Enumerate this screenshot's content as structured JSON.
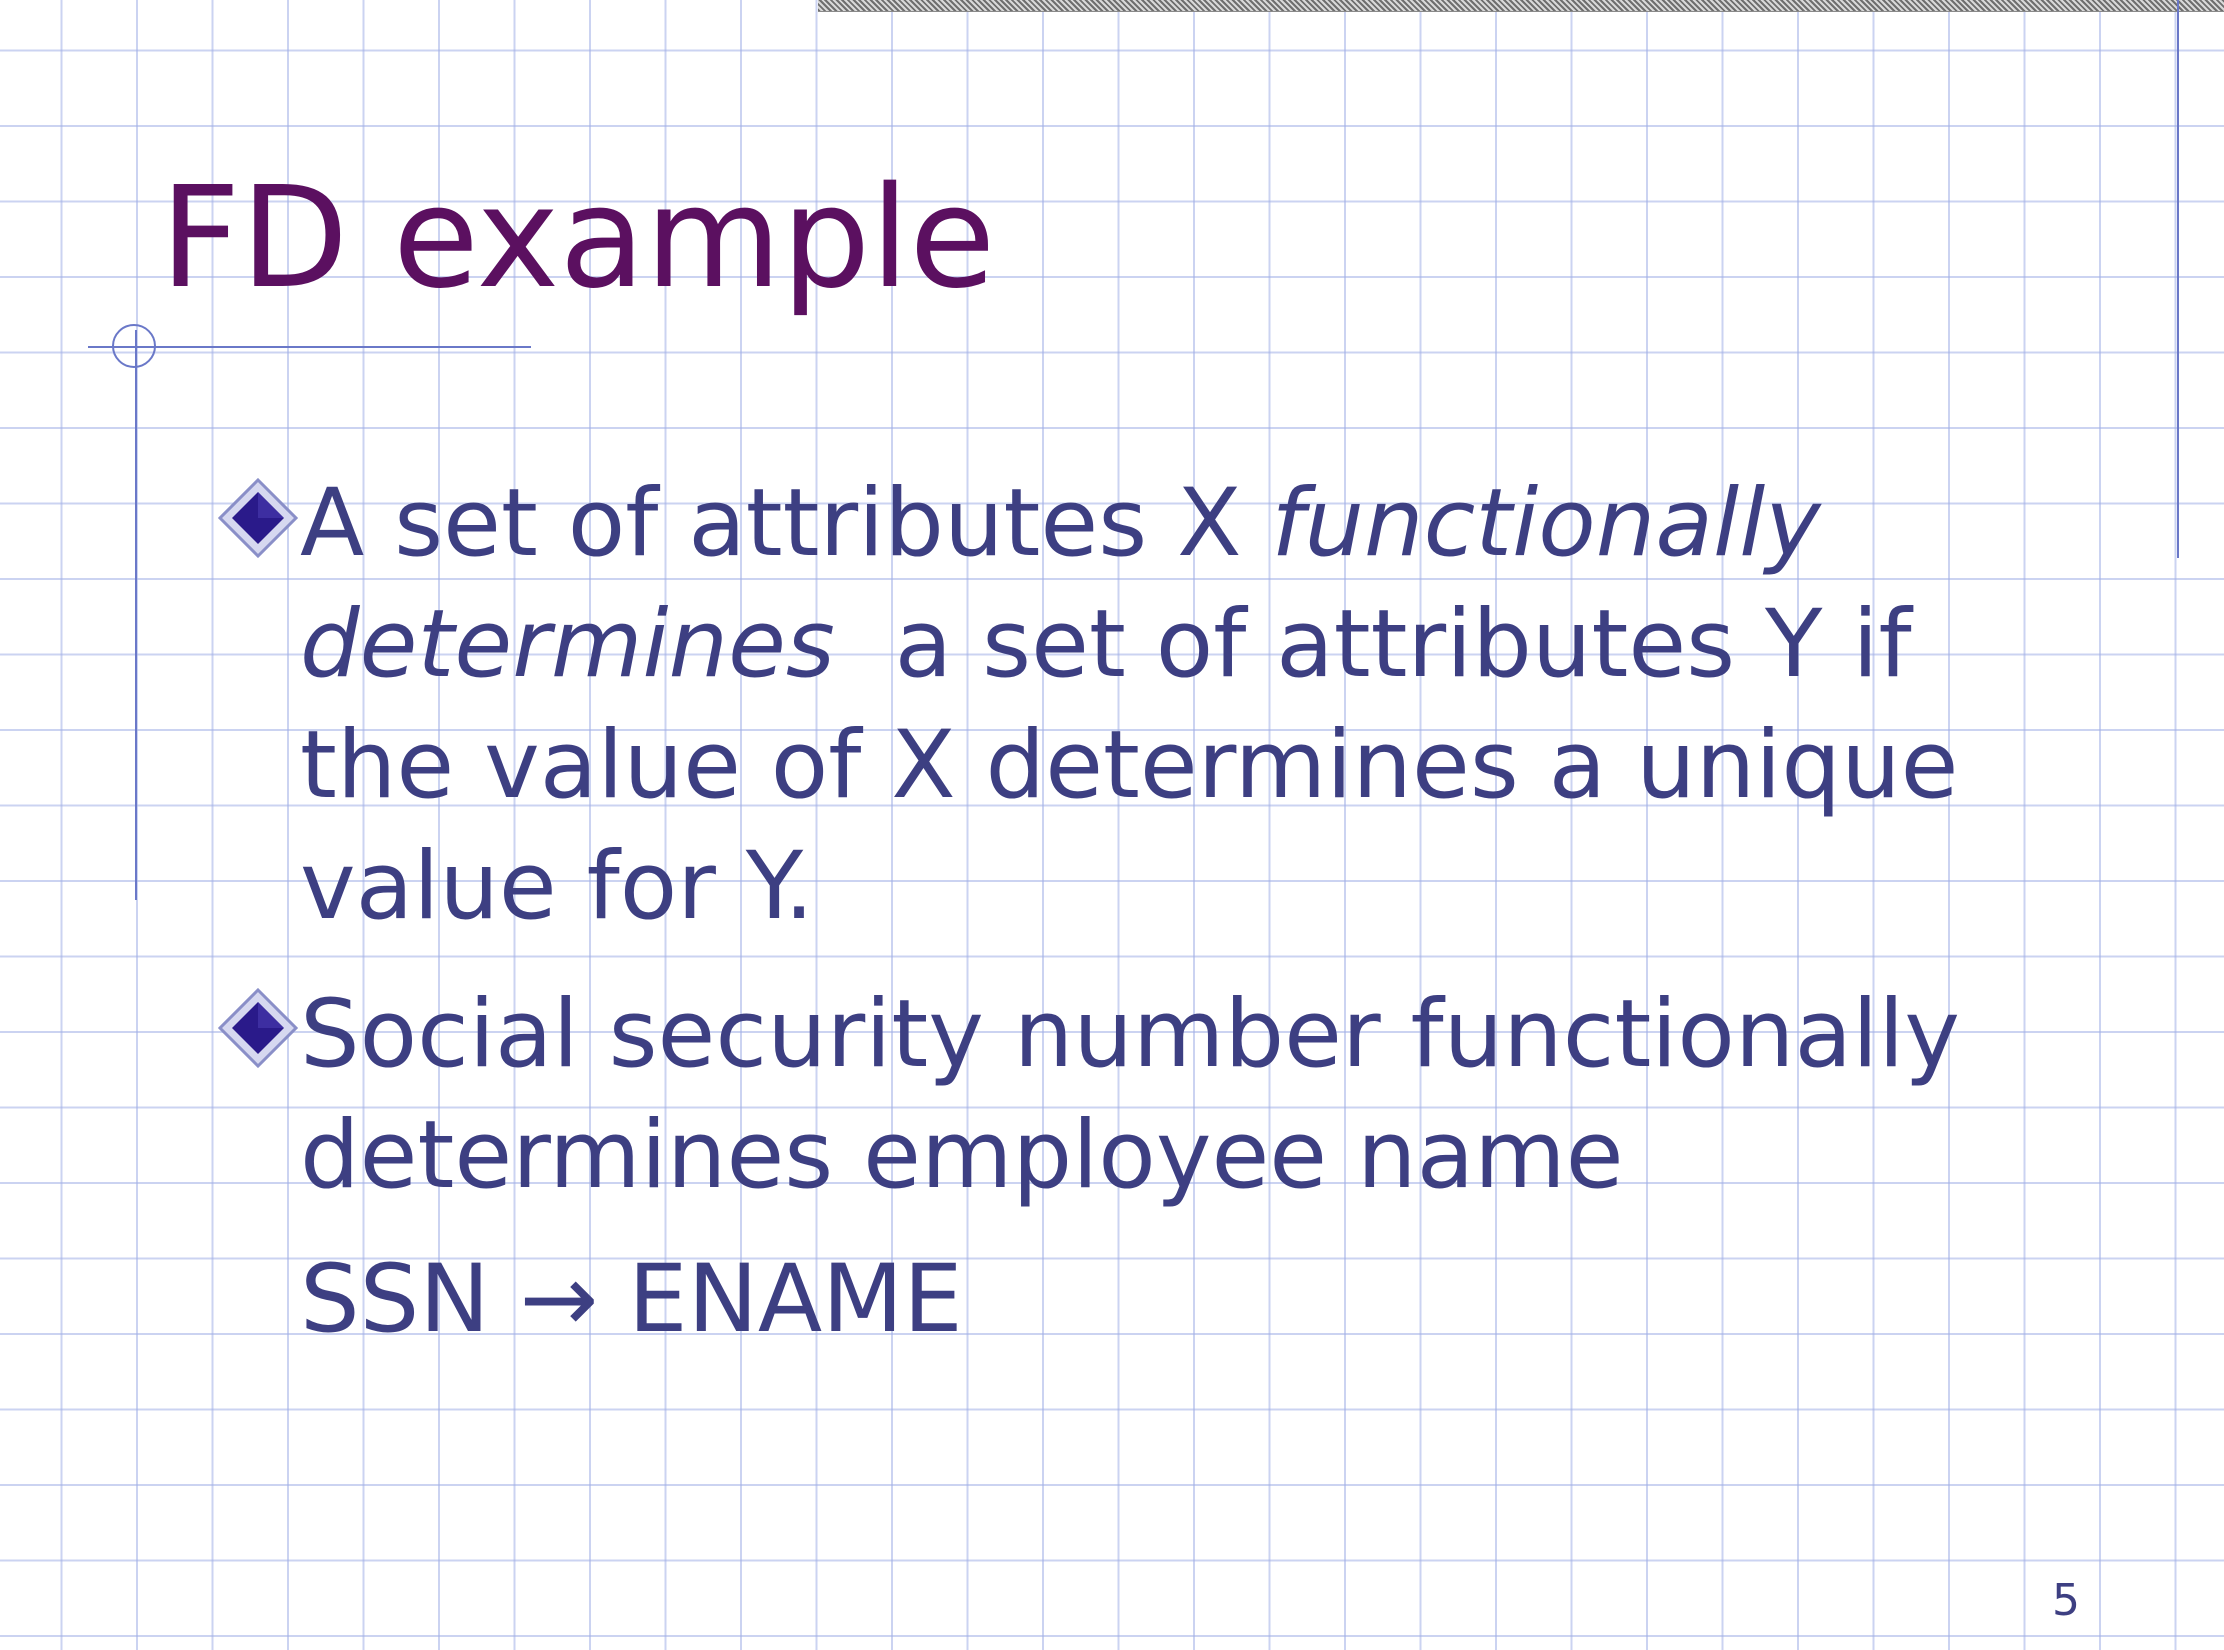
{
  "slide": {
    "title": "FD example",
    "bullets": [
      {
        "line1_normal": "A set of attributes X ",
        "line1_italic": "functionally",
        "line2_italic": "determines",
        "line2_normal": "  a set of attributes Y if",
        "line3": "the value of X determines a unique",
        "line4": "value for Y."
      },
      {
        "line1": "Social security number functionally",
        "line2": "determines employee name"
      }
    ],
    "fd_notation": "SSN → ENAME",
    "page_number": "5"
  },
  "colors": {
    "title": "#5b1060",
    "body_text": "#3d3f82",
    "grid": "#a0afe6",
    "rules": "#6a78c8",
    "bullet_diamond": "#2a1a8a"
  },
  "icons": {
    "bullet": "diamond-bullet-icon"
  }
}
